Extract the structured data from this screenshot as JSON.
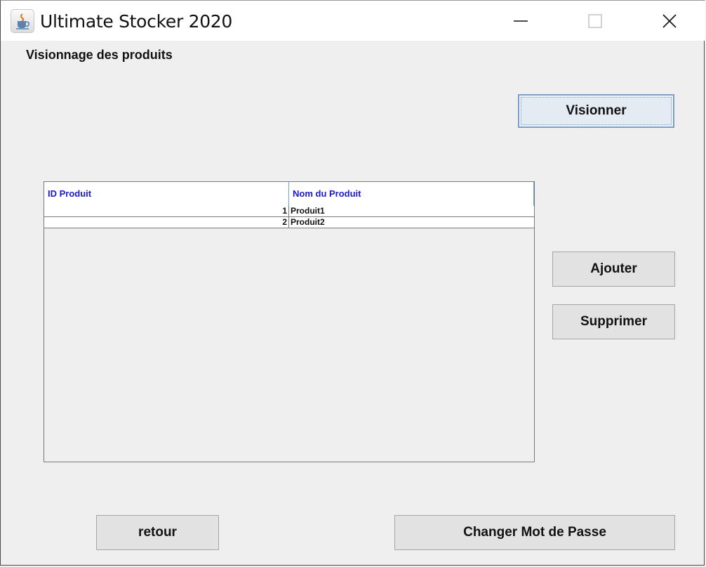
{
  "window": {
    "title": "Ultimate Stocker 2020",
    "icon": "java-cup-icon"
  },
  "heading": "Visionnage des produits",
  "buttons": {
    "visionner": "Visionner",
    "ajouter": "Ajouter",
    "supprimer": "Supprimer",
    "retour": "retour",
    "changer_mdp": "Changer Mot de Passe"
  },
  "table": {
    "columns": [
      "ID Produit",
      "Nom du Produit"
    ],
    "rows": [
      {
        "id": "1",
        "name": "Produit1"
      },
      {
        "id": "2",
        "name": "Produit2"
      }
    ]
  },
  "colors": {
    "header_text": "#1a1ad0",
    "focus_border": "#7a9cc6",
    "button_bg": "#e2e2e2"
  }
}
